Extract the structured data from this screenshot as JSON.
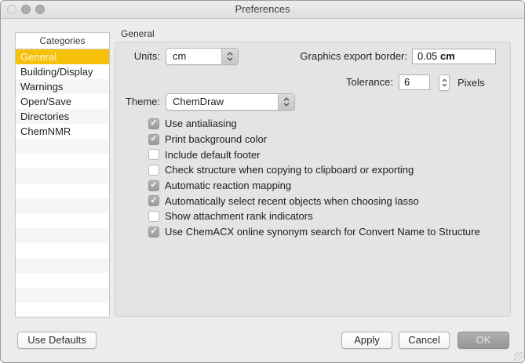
{
  "window": {
    "title": "Preferences"
  },
  "sidebar": {
    "header": "Categories",
    "items": [
      {
        "label": "General",
        "selected": true
      },
      {
        "label": "Building/Display",
        "selected": false
      },
      {
        "label": "Warnings",
        "selected": false
      },
      {
        "label": "Open/Save",
        "selected": false
      },
      {
        "label": "Directories",
        "selected": false
      },
      {
        "label": "ChemNMR",
        "selected": false
      }
    ]
  },
  "panel": {
    "group_label": "General",
    "units": {
      "label": "Units:",
      "value": "cm"
    },
    "graphics_border": {
      "label": "Graphics export border:",
      "value_number": "0.05",
      "value_unit": "cm"
    },
    "tolerance": {
      "label": "Tolerance:",
      "value": "6",
      "suffix": "Pixels"
    },
    "theme": {
      "label": "Theme:",
      "value": "ChemDraw"
    },
    "checkboxes": [
      {
        "label": "Use antialiasing",
        "checked": true
      },
      {
        "label": "Print background color",
        "checked": true
      },
      {
        "label": "Include default footer",
        "checked": false
      },
      {
        "label": "Check structure when copying to clipboard or exporting",
        "checked": false
      },
      {
        "label": "Automatic reaction mapping",
        "checked": true
      },
      {
        "label": "Automatically select recent objects when choosing lasso",
        "checked": true
      },
      {
        "label": "Show attachment rank indicators",
        "checked": false
      },
      {
        "label": "Use ChemACX online synonym search for Convert Name to Structure",
        "checked": true
      }
    ]
  },
  "footer": {
    "use_defaults": "Use Defaults",
    "apply": "Apply",
    "cancel": "Cancel",
    "ok": "OK"
  },
  "icons": {
    "checkmark": "✓"
  },
  "colors": {
    "selection_yellow": "#F5C10B",
    "checked_checkbox_gray": "#A6A6A6",
    "ok_button_gray": "#9E9E9E",
    "window_background": "#ECECEC",
    "groupbox_background": "#E4E4E4"
  }
}
